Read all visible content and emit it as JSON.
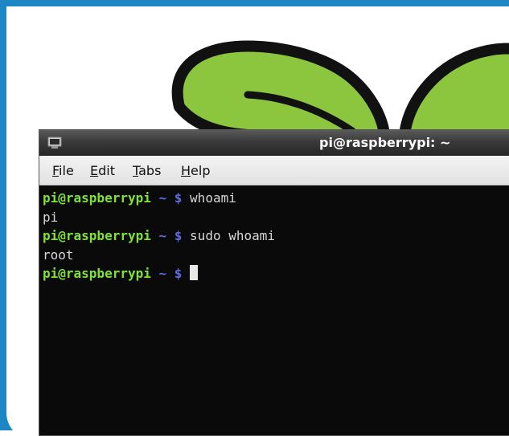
{
  "window": {
    "title": "pi@raspberrypi: ~"
  },
  "menubar": {
    "file": {
      "mnemonic": "F",
      "rest": "ile"
    },
    "edit": {
      "mnemonic": "E",
      "rest": "dit"
    },
    "tabs": {
      "mnemonic": "T",
      "rest": "abs"
    },
    "help": {
      "mnemonic": "H",
      "rest": "elp"
    }
  },
  "terminal": {
    "lines": [
      {
        "user": "pi@raspberrypi",
        "path": "~ $",
        "command": "whoami"
      },
      {
        "output": "pi"
      },
      {
        "user": "pi@raspberrypi",
        "path": "~ $",
        "command": "sudo whoami"
      },
      {
        "output": "root"
      },
      {
        "user": "pi@raspberrypi",
        "path": "~ $",
        "command": ""
      }
    ]
  },
  "colors": {
    "frame": "#1d86c4",
    "leaf": "#8cc63f",
    "leaf_outline": "#111111",
    "prompt_user": "#7ee23a",
    "prompt_path": "#5d6ce0",
    "terminal_bg": "#0a0a0a"
  }
}
